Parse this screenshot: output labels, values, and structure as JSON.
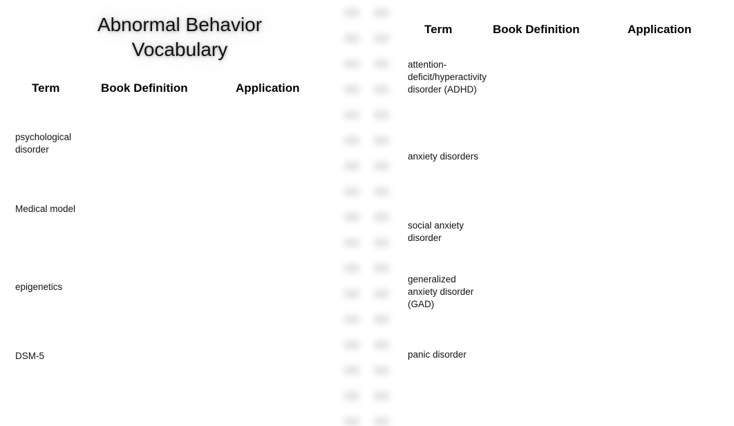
{
  "document": {
    "title": "Abnormal Behavior\nVocabulary",
    "background_color": "#ffffff",
    "text_color": "#111111"
  },
  "left_panel": {
    "headers": {
      "term": "Term",
      "book_definition": "Book Definition",
      "application": "Application"
    },
    "terms": [
      {
        "label": "psychological disorder",
        "book_definition": "",
        "application": ""
      },
      {
        "label": "Medical model",
        "book_definition": "",
        "application": ""
      },
      {
        "label": "epigenetics",
        "book_definition": "",
        "application": ""
      },
      {
        "label": "DSM-5",
        "book_definition": "",
        "application": ""
      }
    ]
  },
  "right_panel": {
    "headers": {
      "term": "Term",
      "book_definition": "Book Definition",
      "application": "Application"
    },
    "terms": [
      {
        "label": "attention-deficit/hyperactivity disorder (ADHD)",
        "book_definition": "",
        "application": ""
      },
      {
        "label": "anxiety disorders",
        "book_definition": "",
        "application": ""
      },
      {
        "label": "social anxiety disorder",
        "book_definition": "",
        "application": ""
      },
      {
        "label": "generalized anxiety disorder (GAD)",
        "book_definition": "",
        "application": ""
      },
      {
        "label": "panic disorder",
        "book_definition": "",
        "application": ""
      }
    ]
  },
  "placeholder_strip": {
    "description": "blurred-placeholder-blocks",
    "columns": 2,
    "rows": 17,
    "row_spacing_px": 37,
    "block_color": "#e2e2e2"
  }
}
